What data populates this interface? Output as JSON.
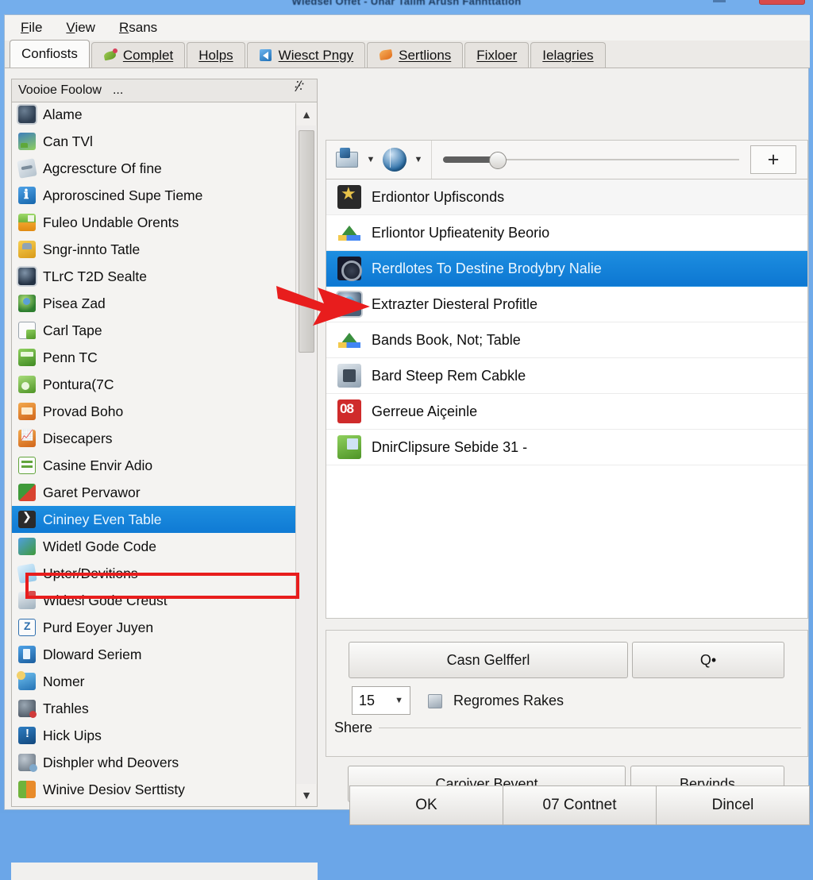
{
  "window": {
    "title": "Wiedsel Offet - Uhar Talim Arush Fannttation",
    "close_label": "",
    "minimize_label": ""
  },
  "menu": {
    "items": [
      {
        "label": "File",
        "mnemonic": "F"
      },
      {
        "label": "View",
        "mnemonic": "V"
      },
      {
        "label": "Rsans",
        "mnemonic": "R"
      }
    ]
  },
  "tabs": [
    {
      "label": "Confiosts",
      "icon": "none",
      "active": true
    },
    {
      "label": "Complet",
      "icon": "leaf-icon",
      "active": false
    },
    {
      "label": "Holps",
      "icon": "none",
      "active": false
    },
    {
      "label": "Wiesct Pngy",
      "icon": "speaker-icon",
      "active": false
    },
    {
      "label": "Sertlions",
      "icon": "diamond-icon",
      "active": false
    },
    {
      "label": "Fixloer",
      "icon": "none",
      "active": false
    },
    {
      "label": "Ielagries",
      "icon": "none",
      "active": false
    }
  ],
  "sidebar": {
    "search": {
      "value": "Vooioe Foolow",
      "ellipsis": "...",
      "glyph": "scissors-icon"
    },
    "items": [
      {
        "label": "Alame",
        "icon": "globe-icon"
      },
      {
        "label": "Can TVl",
        "icon": "photo-icon"
      },
      {
        "label": "Agcrescture Of fine",
        "icon": "tool-icon"
      },
      {
        "label": "Aproroscined Supe Tieme",
        "icon": "info-blue-icon"
      },
      {
        "label": "Fuleo Undable Orents",
        "icon": "drawer-icon"
      },
      {
        "label": "Sngr-innto Tatle",
        "icon": "shield-icon"
      },
      {
        "label": "TLrC T2D Sealte",
        "icon": "dark-globe-icon"
      },
      {
        "label": "Pisea Zad",
        "icon": "green-globe-icon"
      },
      {
        "label": "Carl Tape",
        "icon": "window-icon"
      },
      {
        "label": "Penn TC",
        "icon": "calculator-icon"
      },
      {
        "label": "Pontura(7C",
        "icon": "pontura-icon"
      },
      {
        "label": "Provad Boho",
        "icon": "orange-icon"
      },
      {
        "label": "Disecapers",
        "icon": "orange-chart-icon"
      },
      {
        "label": "Casine Envir Adio",
        "icon": "green-list-icon"
      },
      {
        "label": "Garet Pervawor",
        "icon": "red-green-icon"
      },
      {
        "label": "Cininey Even Table",
        "icon": "dark-console-icon",
        "selected": true,
        "highlighted": true
      },
      {
        "label": "Widetl Gode Code",
        "icon": "blue-green-icon"
      },
      {
        "label": "Upter/Devitions",
        "icon": "upter-icon"
      },
      {
        "label": "Widesl Gode Creust",
        "icon": "printer-icon"
      },
      {
        "label": "Purd Eoyer Juyen",
        "icon": "z-blue-icon"
      },
      {
        "label": "Dloward Seriem",
        "icon": "dloward-icon"
      },
      {
        "label": "Nomer",
        "icon": "nomer-icon"
      },
      {
        "label": "Trahles",
        "icon": "trahles-icon"
      },
      {
        "label": "Hick Uips",
        "icon": "hick-info-icon"
      },
      {
        "label": "Dishpler whd Deovers",
        "icon": "dishple-icon"
      },
      {
        "label": "Winive Desiov Serttisty",
        "icon": "winive-icon"
      }
    ],
    "scrollbar": {
      "up_glyph": "chevron-up-icon",
      "down_glyph": "chevron-down-icon"
    }
  },
  "right_toolbar": {
    "stamp_icon": "stamp-icon",
    "globe_icon": "globe-icon",
    "caret": "▼",
    "plus_label": "+",
    "slider_value": 12
  },
  "right_list": {
    "items": [
      {
        "label": "Erdiontor Upfisconds",
        "icon": "star-icon",
        "state": "first"
      },
      {
        "label": "Erliontor Upfieatenity Beorio",
        "icon": "drive-icon",
        "state": "normal"
      },
      {
        "label": "Rerdlotes To Destine Brodybry Nalie",
        "icon": "disc-icon",
        "state": "selected"
      },
      {
        "label": "Extrazter Diesteral Profitle",
        "icon": "blue-globe-icon",
        "state": "normal",
        "arrow_target": true
      },
      {
        "label": "Bands Book, Not; Table",
        "icon": "drive-icon",
        "state": "normal"
      },
      {
        "label": "Bard Steep Rem Cabkle",
        "icon": "bard-icon",
        "state": "normal"
      },
      {
        "label": "Gerreue Aiçeinle",
        "icon": "red-08-icon",
        "state": "normal"
      },
      {
        "label": "DnirClipsure Sebide 31 -",
        "icon": "clipsure-icon",
        "state": "normal"
      }
    ]
  },
  "options": {
    "casn_button": "Casn Gelfferl",
    "q_button": "Q•",
    "combo_value": "15",
    "combo_caret": "▼",
    "regromes_icon": "stack-icon",
    "regromes_label": "Regromes Rakes",
    "shere_label": "Shere"
  },
  "actions": {
    "caroiver_button": "Caroiver Bevent",
    "bervinds_button": "Bervinds"
  },
  "dialog_buttons": [
    {
      "label": "OK"
    },
    {
      "label": "07 Contnet"
    },
    {
      "label": "Dincel"
    }
  ],
  "colors": {
    "window_chrome": "#6ba6e8",
    "selection_blue": "#0f7ad4",
    "highlight_red": "#e81d1d",
    "panel_bg": "#f1f0ee"
  }
}
